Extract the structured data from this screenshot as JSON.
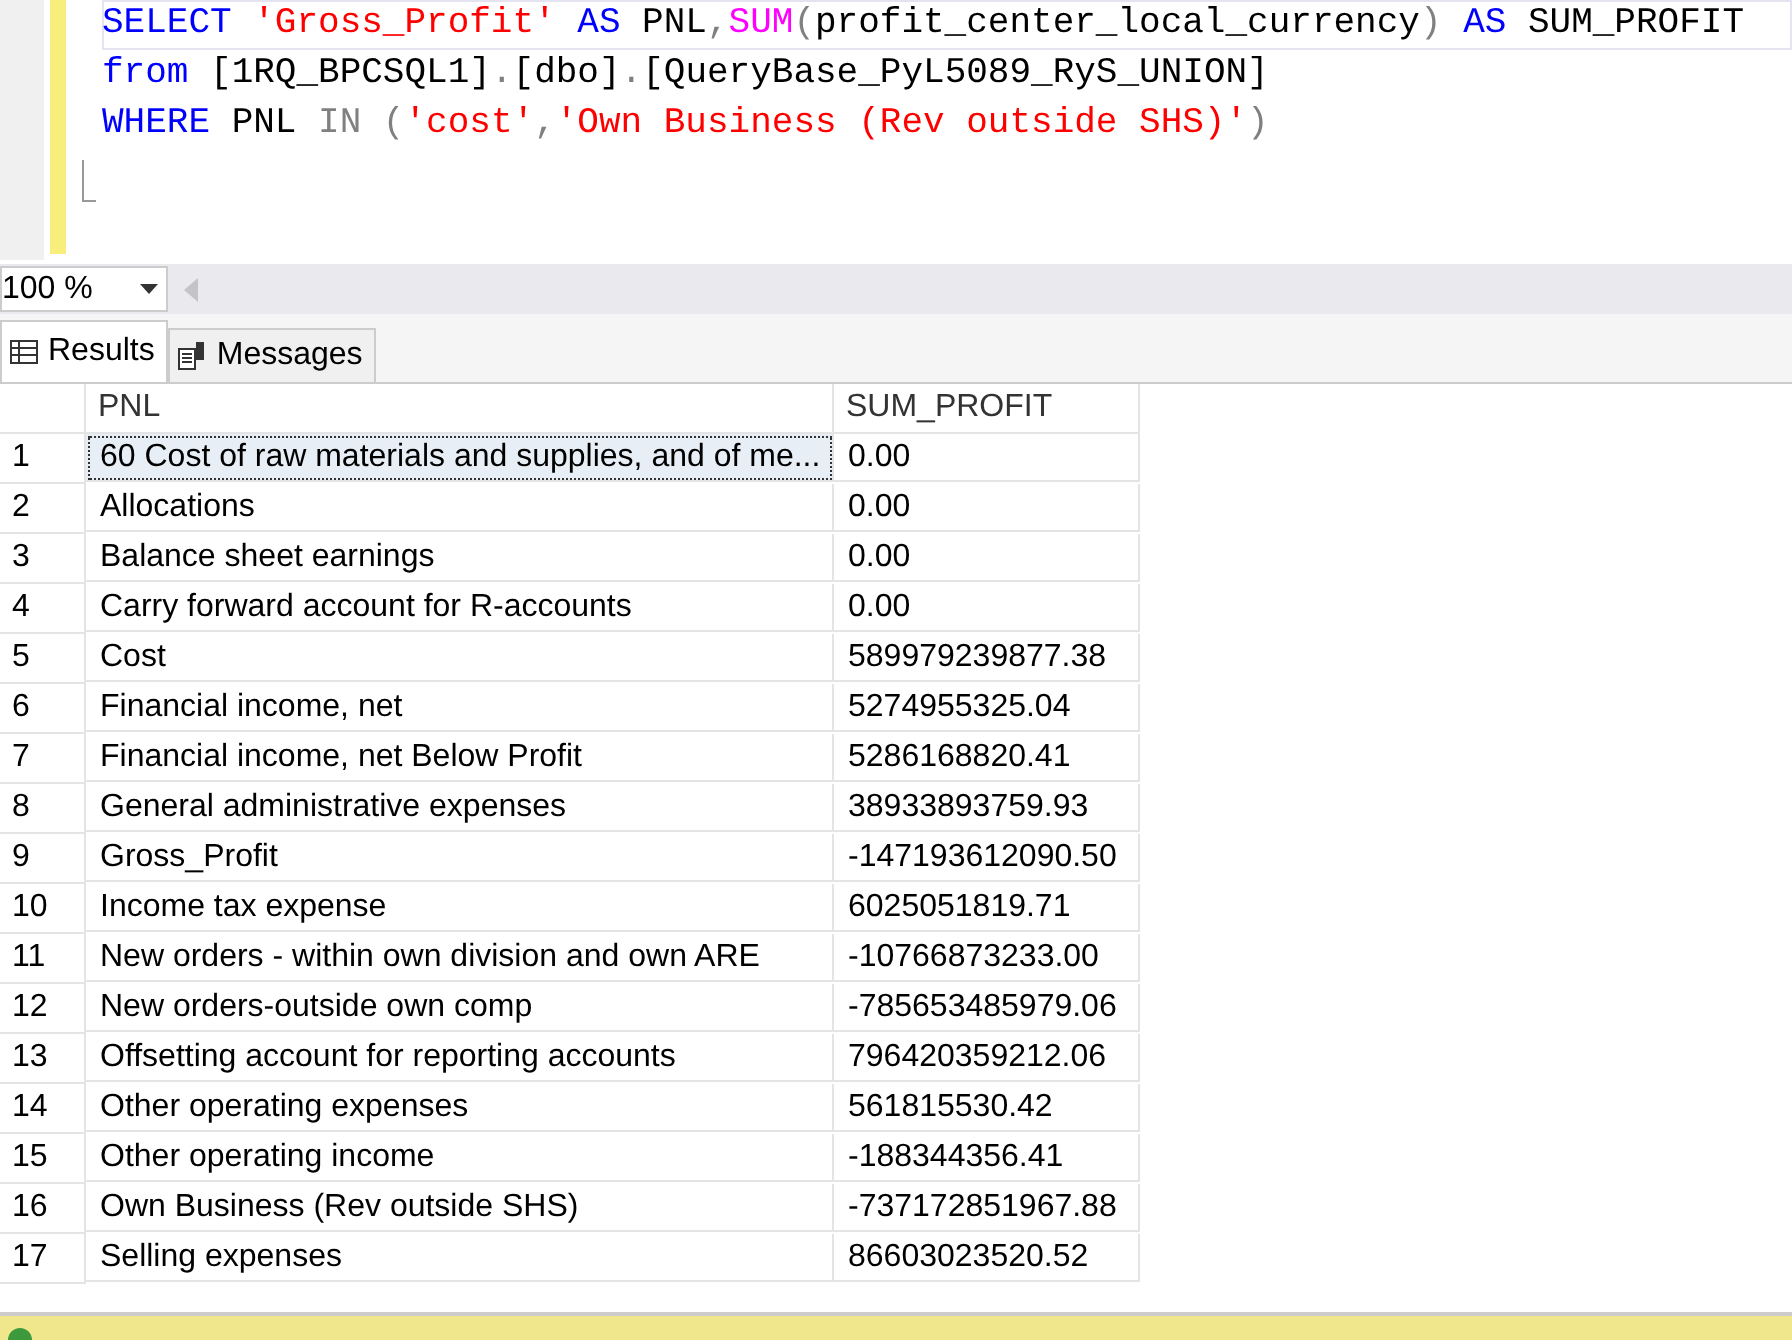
{
  "editor": {
    "lines": [
      [
        {
          "kind": "keyword",
          "text": "SELECT"
        },
        {
          "kind": "string",
          "text": " 'Gross_Profit'"
        },
        {
          "kind": "keyword",
          "text": " AS"
        },
        {
          "kind": "plain",
          "text": " PNL"
        },
        {
          "kind": "operator",
          "text": ","
        },
        {
          "kind": "function",
          "text": "SUM"
        },
        {
          "kind": "operator",
          "text": "("
        },
        {
          "kind": "plain",
          "text": "profit_center_local_currency"
        },
        {
          "kind": "operator",
          "text": ")"
        },
        {
          "kind": "keyword",
          "text": " AS"
        },
        {
          "kind": "plain",
          "text": " SUM_PROFIT"
        }
      ],
      [
        {
          "kind": "keyword",
          "text": "from"
        },
        {
          "kind": "plain",
          "text": " [1RQ_BPCSQL1]"
        },
        {
          "kind": "operator",
          "text": "."
        },
        {
          "kind": "plain",
          "text": "[dbo]"
        },
        {
          "kind": "operator",
          "text": "."
        },
        {
          "kind": "plain",
          "text": "[QueryBase_PyL5089_RyS_UNION]"
        }
      ],
      [
        {
          "kind": "keyword",
          "text": "WHERE"
        },
        {
          "kind": "plain",
          "text": " PNL "
        },
        {
          "kind": "operator",
          "text": "IN ("
        },
        {
          "kind": "string",
          "text": "'cost'"
        },
        {
          "kind": "operator",
          "text": ","
        },
        {
          "kind": "string",
          "text": "'Own Business (Rev outside SHS)'"
        },
        {
          "kind": "operator",
          "text": ")"
        }
      ]
    ]
  },
  "zoom": {
    "value": "100 %"
  },
  "tabs": [
    {
      "label": "Results",
      "selected": true,
      "kind": "grid"
    },
    {
      "label": "Messages",
      "selected": false,
      "kind": "messages"
    }
  ],
  "table": {
    "columns": [
      "PNL",
      "SUM_PROFIT"
    ],
    "rows": [
      {
        "number": "1",
        "cells": [
          "60 Cost of raw materials and supplies, and of me...",
          "0.00"
        ],
        "selected": true
      },
      {
        "number": "2",
        "cells": [
          "Allocations",
          "0.00"
        ],
        "selected": false
      },
      {
        "number": "3",
        "cells": [
          "Balance sheet earnings",
          "0.00"
        ],
        "selected": false
      },
      {
        "number": "4",
        "cells": [
          "Carry forward account for R-accounts",
          "0.00"
        ],
        "selected": false
      },
      {
        "number": "5",
        "cells": [
          "Cost",
          "589979239877.38"
        ],
        "selected": false
      },
      {
        "number": "6",
        "cells": [
          "Financial income, net",
          "5274955325.04"
        ],
        "selected": false
      },
      {
        "number": "7",
        "cells": [
          "Financial income, net Below Profit",
          "5286168820.41"
        ],
        "selected": false
      },
      {
        "number": "8",
        "cells": [
          "General administrative expenses",
          "38933893759.93"
        ],
        "selected": false
      },
      {
        "number": "9",
        "cells": [
          "Gross_Profit",
          "-147193612090.50"
        ],
        "selected": false
      },
      {
        "number": "10",
        "cells": [
          "Income tax expense",
          "6025051819.71"
        ],
        "selected": false
      },
      {
        "number": "11",
        "cells": [
          "New orders - within own division and own ARE",
          "-10766873233.00"
        ],
        "selected": false
      },
      {
        "number": "12",
        "cells": [
          "New orders-outside own comp",
          "-785653485979.06"
        ],
        "selected": false
      },
      {
        "number": "13",
        "cells": [
          "Offsetting account for reporting accounts",
          "796420359212.06"
        ],
        "selected": false
      },
      {
        "number": "14",
        "cells": [
          "Other operating expenses",
          "561815530.42"
        ],
        "selected": false
      },
      {
        "number": "15",
        "cells": [
          "Other operating income",
          "-188344356.41"
        ],
        "selected": false
      },
      {
        "number": "16",
        "cells": [
          "Own Business (Rev outside SHS)",
          "-737172851967.88"
        ],
        "selected": false
      },
      {
        "number": "17",
        "cells": [
          "Selling expenses",
          "86603023520.52"
        ],
        "selected": false
      }
    ]
  },
  "status_bar": {
    "success": true
  }
}
